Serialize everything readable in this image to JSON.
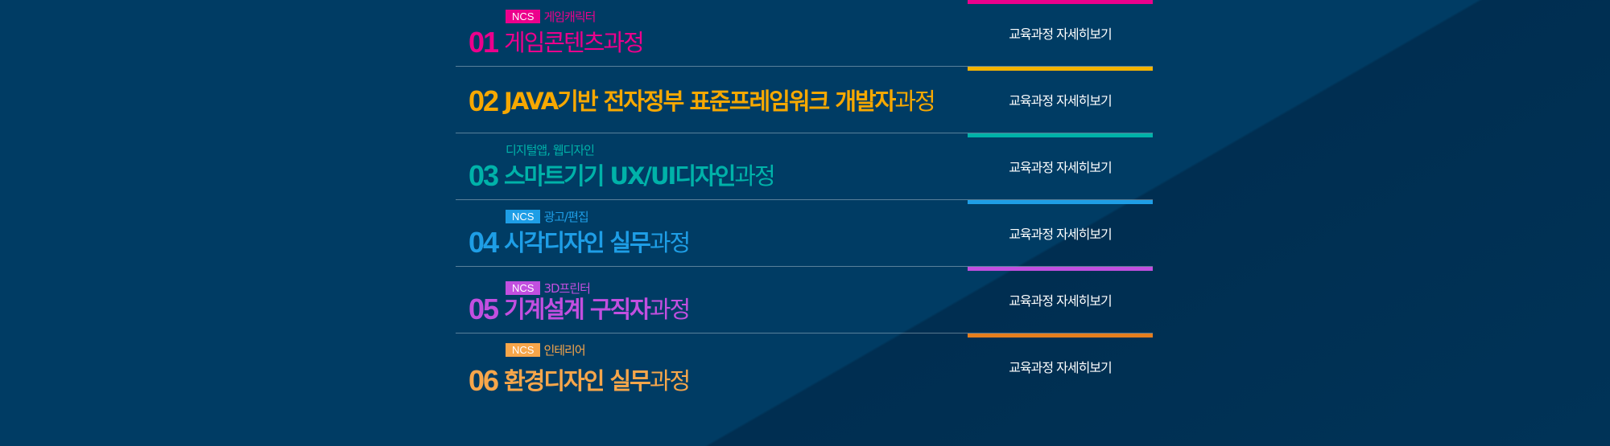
{
  "courses": [
    {
      "num": "01",
      "badge": "NCS",
      "subtitle": "게임캐릭터",
      "title_main": "게임콘텐츠",
      "title_suffix": "과정",
      "button": "교육과정 자세히보기",
      "color": "#ec008c",
      "badge_color": "#ec008c"
    },
    {
      "num": "02",
      "badge": "",
      "subtitle": "",
      "title_main": "JAVA기반 전자정부 표준프레임워크 개발자",
      "title_suffix": "과정",
      "button": "교육과정 자세히보기",
      "color": "#f7a800",
      "badge_color": ""
    },
    {
      "num": "03",
      "badge": "",
      "subtitle": "디지털앱, 웹디자인",
      "title_main": "스마트기기 UX/UI디자인",
      "title_suffix": "과정",
      "button": "교육과정 자세히보기",
      "color": "#00b2a9",
      "badge_color": ""
    },
    {
      "num": "04",
      "badge": "NCS",
      "subtitle": "광고/편집",
      "title_main": "시각디자인 실무",
      "title_suffix": "과정",
      "button": "교육과정 자세히보기",
      "color": "#1e9ee6",
      "badge_color": "#1e9ee6"
    },
    {
      "num": "05",
      "badge": "NCS",
      "subtitle": "3D프린터",
      "title_main": "기계설계 구직자",
      "title_suffix": "과정",
      "button": "교육과정 자세히보기",
      "color": "#c24fe0",
      "badge_color": "#c24fe0"
    },
    {
      "num": "06",
      "badge": "NCS",
      "subtitle": "인테리어",
      "title_main": "환경디자인 실무",
      "title_suffix": "과정",
      "button": "교육과정 자세히보기",
      "color": "#f7a64a",
      "badge_color": "#f7a64a"
    }
  ],
  "bar_colors": [
    "#ec008c",
    "#f4b400",
    "#00b2a9",
    "#1e9ee6",
    "#c24fe0",
    "#e57e1e"
  ]
}
